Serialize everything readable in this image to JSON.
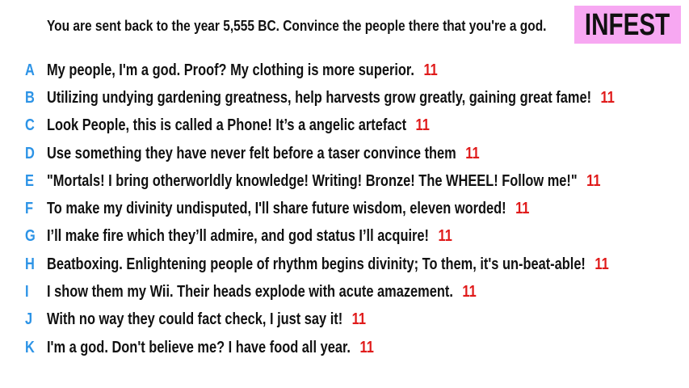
{
  "prompt": "You are sent back to the year 5,555 BC. Convince the people there that you're a god.",
  "brand": "INFEST",
  "colors": {
    "letter": "#2c93e6",
    "score": "#e01a1a",
    "brand_bg": "#f7a8f2",
    "text": "#111111"
  },
  "answers": [
    {
      "letter": "A",
      "text": "My people, I'm a god. Proof? My clothing is more superior.",
      "score": "11"
    },
    {
      "letter": "B",
      "text": "Utilizing undying gardening greatness, help harvests grow greatly, gaining great fame!",
      "score": "11"
    },
    {
      "letter": "C",
      "text": "Look People, this is called a Phone! It’s a angelic artefact",
      "score": "11"
    },
    {
      "letter": "D",
      "text": "Use something they have never felt before a taser convince them",
      "score": "11"
    },
    {
      "letter": "E",
      "text": "\"Mortals! I bring otherworldly knowledge! Writing! Bronze! The WHEEL! Follow me!\"",
      "score": "11"
    },
    {
      "letter": "F",
      "text": "To make my divinity undisputed, I'll share future wisdom, eleven worded!",
      "score": "11"
    },
    {
      "letter": "G",
      "text": "I’ll make fire which they’ll admire, and god status I’ll acquire!",
      "score": "11"
    },
    {
      "letter": "H",
      "text": "Beatboxing. Enlightening people of rhythm begins divinity; To them, it's un-beat-able!",
      "score": "11"
    },
    {
      "letter": "I",
      "text": "I show them my Wii. Their heads explode with acute amazement.",
      "score": "11"
    },
    {
      "letter": "J",
      "text": "With no way they could fact check, I just say it!",
      "score": "11"
    },
    {
      "letter": "K",
      "text": "I'm a god. Don't believe me? I have food all year.",
      "score": "11"
    }
  ]
}
